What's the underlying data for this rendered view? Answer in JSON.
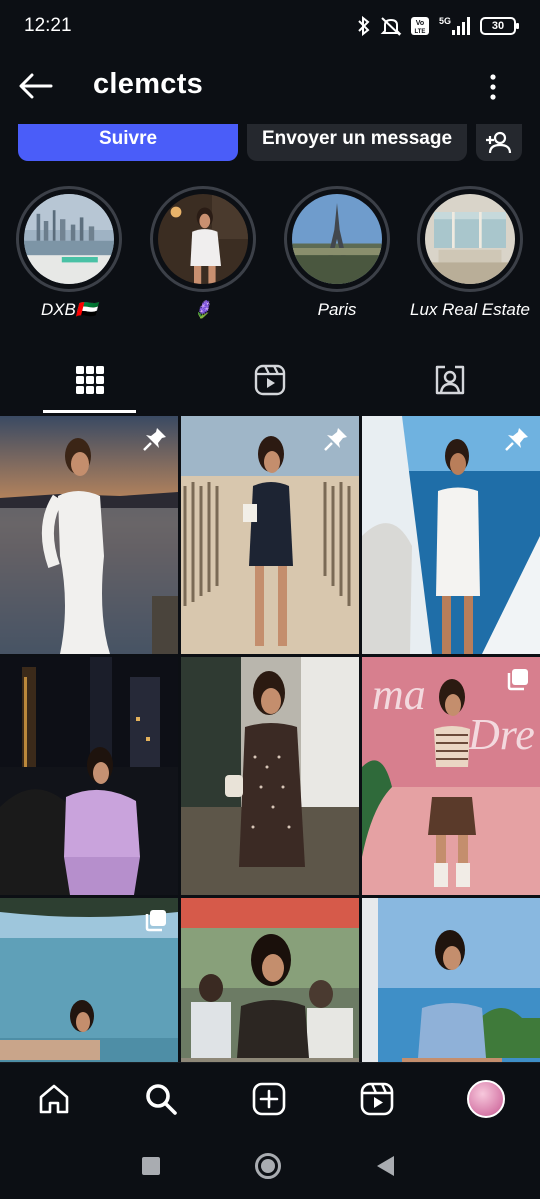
{
  "status_bar": {
    "time": "12:21",
    "network": "5G",
    "volte": "Vo LTE",
    "battery": "30"
  },
  "header": {
    "username": "clemcts"
  },
  "actions": {
    "follow_label": "Suivre",
    "message_label": "Envoyer un message"
  },
  "highlights": [
    {
      "label": "DXB🇦🇪"
    },
    {
      "label": "🪻"
    },
    {
      "label": "Paris"
    },
    {
      "label": "Lux Real Estate"
    }
  ],
  "tabs": [
    {
      "name": "posts-grid",
      "active": true
    },
    {
      "name": "reels",
      "active": false
    },
    {
      "name": "tagged",
      "active": false
    }
  ],
  "grid_posts": [
    {
      "scene": "sunset sea, white dress",
      "badge": "pin"
    },
    {
      "scene": "beach fence, polka dress",
      "badge": "pin"
    },
    {
      "scene": "boat, white outfit",
      "badge": "pin"
    },
    {
      "scene": "city night, lilac dress",
      "badge": "none"
    },
    {
      "scene": "terrace, polka dress",
      "badge": "none"
    },
    {
      "scene": "pink wall, striped top",
      "badge": "carousel"
    },
    {
      "scene": "sea view",
      "badge": "carousel"
    },
    {
      "scene": "restaurant",
      "badge": "none"
    },
    {
      "scene": "coast, blue top",
      "badge": "none"
    }
  ],
  "colors": {
    "background": "#0c0f14",
    "accent": "#4a5df9",
    "secondary_button": "#25282e"
  }
}
